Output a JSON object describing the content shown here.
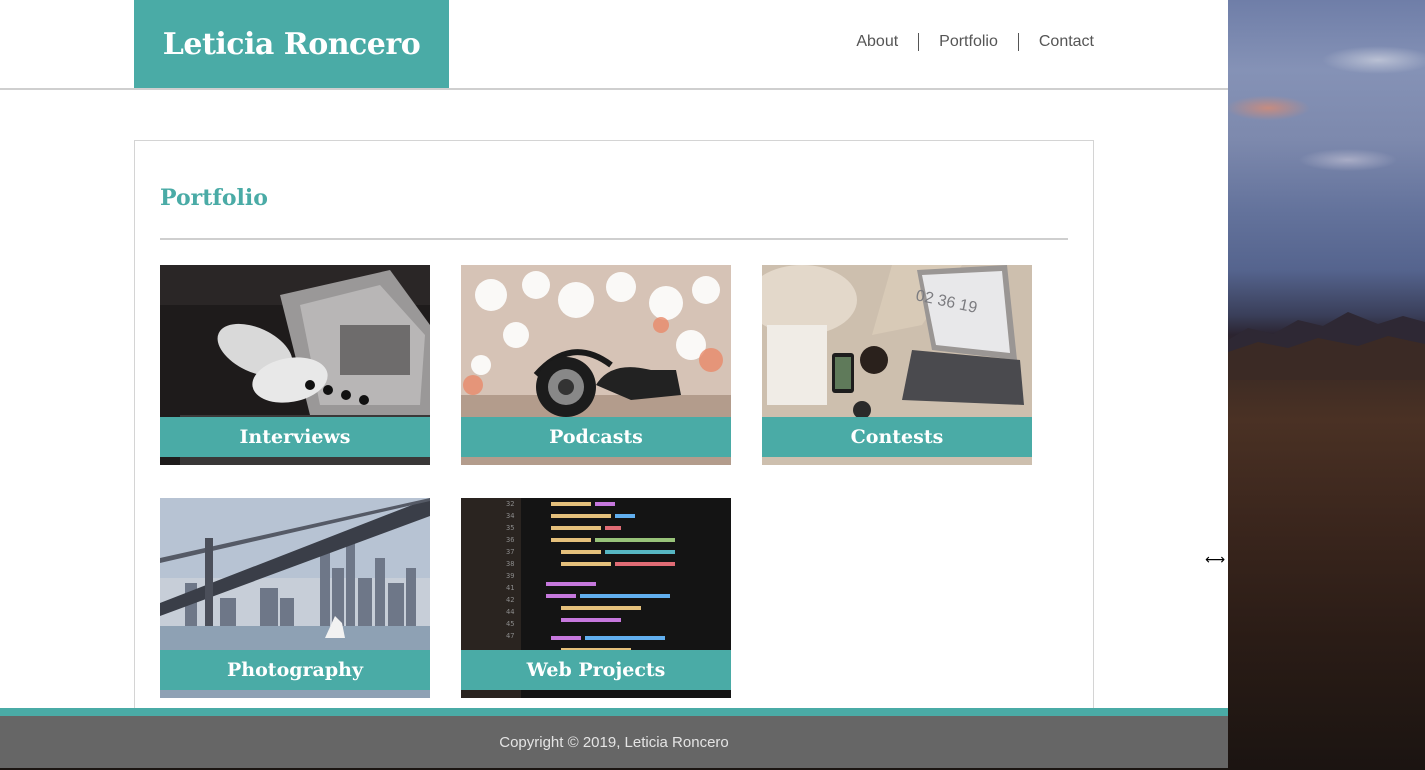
{
  "site": {
    "brand": "Leticia Roncero",
    "nav": [
      {
        "label": "About"
      },
      {
        "label": "Portfolio"
      },
      {
        "label": "Contact"
      }
    ]
  },
  "portfolio": {
    "title": "Portfolio",
    "items": [
      {
        "label": "Interviews",
        "image": "typewriter-hands-photo"
      },
      {
        "label": "Podcasts",
        "image": "headphones-photo"
      },
      {
        "label": "Contests",
        "image": "laptop-desk-photo",
        "image_text": "02 36 19"
      },
      {
        "label": "Photography",
        "image": "bay-bridge-city-photo"
      },
      {
        "label": "Web Projects",
        "image": "code-editor-photo"
      }
    ]
  },
  "footer": {
    "copyright": "Copyright © 2019, Leticia Roncero"
  },
  "colors": {
    "accent": "#4aaba6",
    "footer": "#666666",
    "nav_text": "#555555"
  },
  "cursor": "resize-horizontal-icon"
}
